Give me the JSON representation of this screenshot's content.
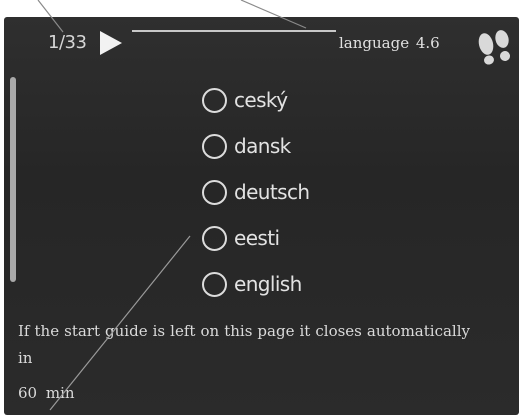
{
  "header": {
    "page_counter": "1/33",
    "menu_title": "language  4.6"
  },
  "icons": {
    "next": "play-arrow-icon",
    "guide": "footsteps-icon"
  },
  "language_options": [
    {
      "label": "ceský",
      "selected": false
    },
    {
      "label": "dansk",
      "selected": false
    },
    {
      "label": "deutsch",
      "selected": false
    },
    {
      "label": "eesti",
      "selected": false
    },
    {
      "label": "english",
      "selected": false
    }
  ],
  "info": {
    "message": "If the start guide is left on this page it closes automatically in",
    "countdown": "60  min"
  },
  "colors": {
    "screen_background": "#2a2a2a",
    "text": "#e0e0e0",
    "page_background": "#ffffff"
  }
}
